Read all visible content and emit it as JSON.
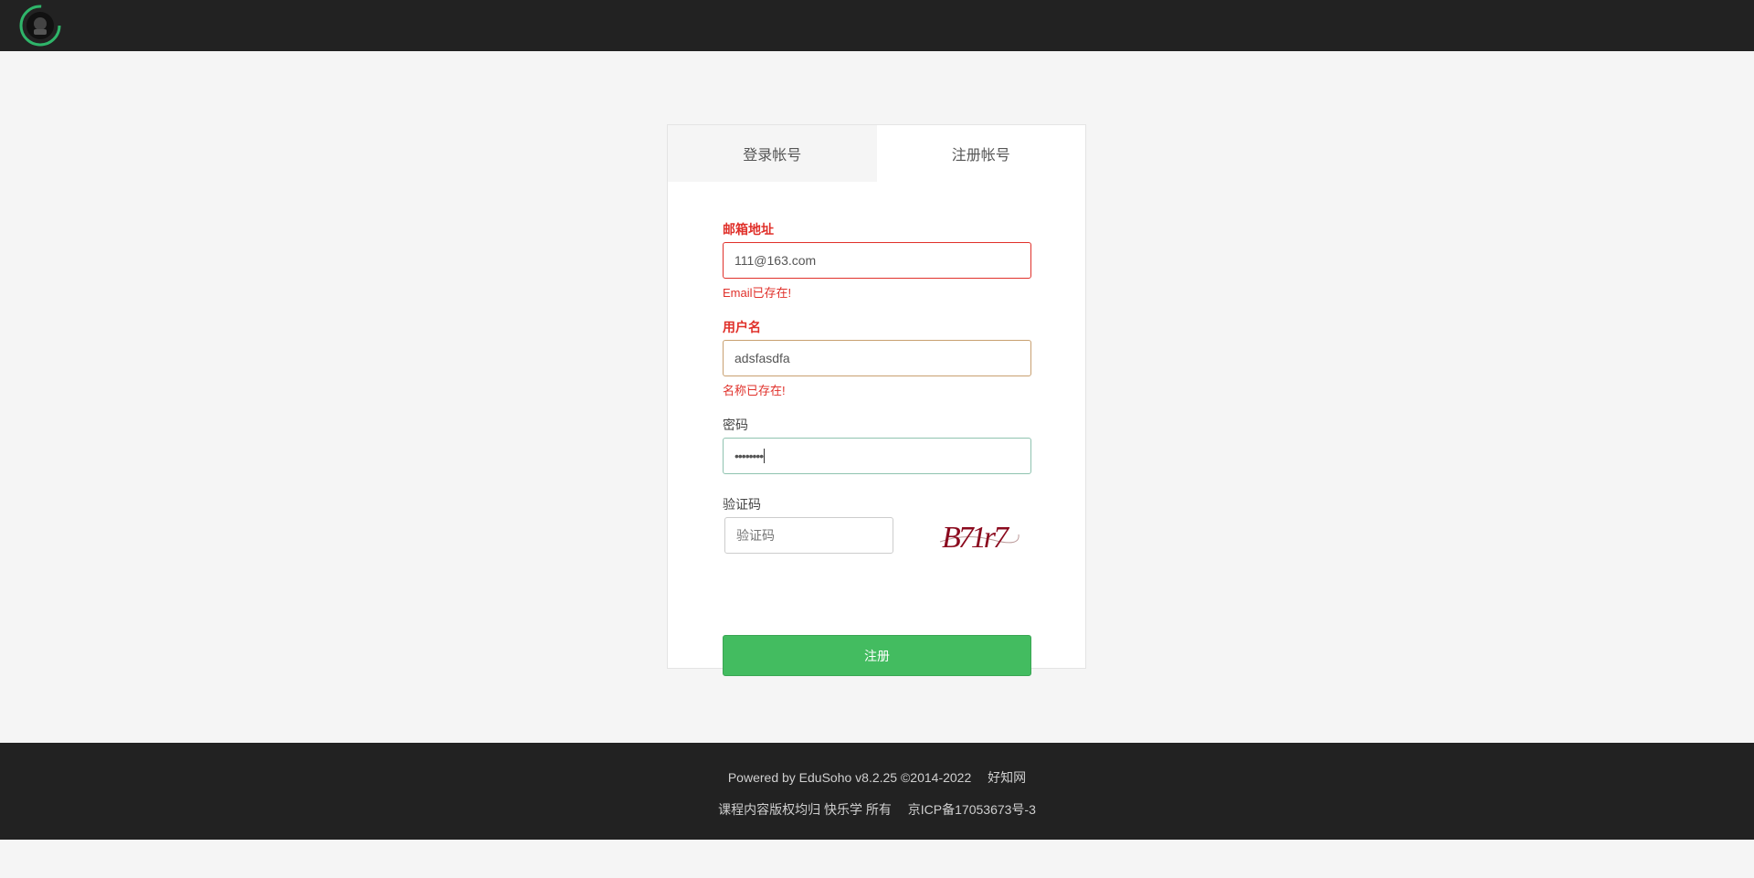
{
  "tabs": {
    "login": "登录帐号",
    "register": "注册帐号"
  },
  "form": {
    "email": {
      "label": "邮箱地址",
      "value": "111@163.com",
      "error": "Email已存在!"
    },
    "username": {
      "label": "用户名",
      "value": "adsfasdfa",
      "error": "名称已存在!"
    },
    "password": {
      "label": "密码",
      "value": "••••••••"
    },
    "captcha": {
      "label": "验证码",
      "placeholder": "验证码",
      "image_text": "B71r7"
    },
    "submit_label": "注册"
  },
  "footer": {
    "powered": "Powered by",
    "brand": "EduSoho v8.2.25",
    "copyright": "©2014-2022",
    "site": "好知网",
    "rights": "课程内容版权均归 快乐学 所有",
    "icp": "京ICP备17053673号-3"
  },
  "colors": {
    "error": "#e0302a",
    "primary": "#43bc60",
    "topbar": "#222222"
  }
}
